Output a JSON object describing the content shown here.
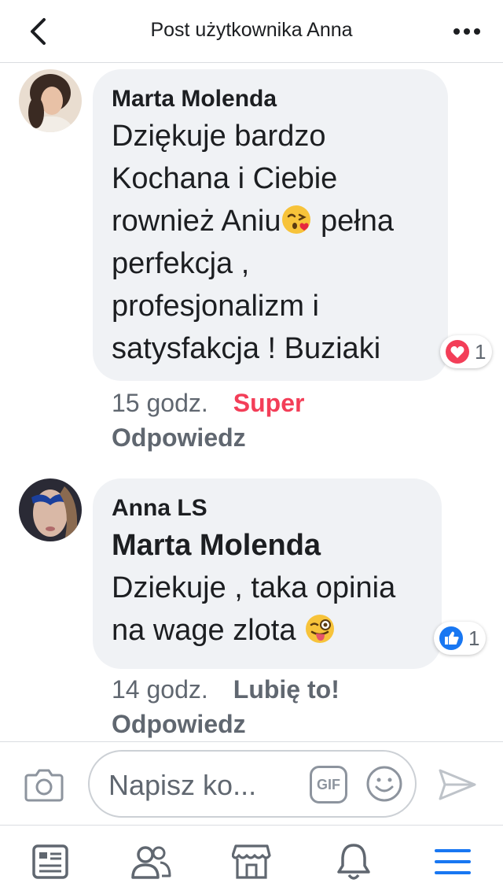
{
  "header": {
    "title": "Post użytkownika Anna",
    "back_icon": "chevron-left-icon",
    "more_icon": "more-dots-icon"
  },
  "comments": [
    {
      "author": "Marta Molenda",
      "text_lines": [
        "Dziękuje bardzo",
        "Kochana i Ciebie",
        "rownież Aniu",
        "perfekcja ,",
        "profesjonalizm i",
        "satysfakcja ! Buziaki"
      ],
      "line3_suffix": " pełna",
      "emoji": "kissing-face-emoji",
      "reaction": {
        "type": "love",
        "count": "1"
      },
      "time": "15 godz.",
      "reaction_label": "Super",
      "reply_label": "Odpowiedz"
    },
    {
      "author": "Anna LS",
      "mention": "Marta Molenda",
      "text_lines": [
        "Dziekuje , taka opinia",
        "na wage zlota"
      ],
      "emoji": "winking-tongue-emoji",
      "reaction": {
        "type": "like",
        "count": "1"
      },
      "time": "14 godz.",
      "reaction_label": "Lubię to!",
      "reply_label": "Odpowiedz"
    }
  ],
  "composer": {
    "placeholder": "Napisz ko...",
    "gif_label": "GIF",
    "camera_icon": "camera-icon",
    "smile_icon": "smiley-icon",
    "send_icon": "send-icon"
  },
  "tabs": [
    {
      "icon": "news-feed-icon"
    },
    {
      "icon": "friends-icon"
    },
    {
      "icon": "marketplace-icon"
    },
    {
      "icon": "notifications-bell-icon"
    },
    {
      "icon": "menu-hamburger-icon"
    }
  ],
  "colors": {
    "bubble": "#f0f2f5",
    "love": "#f33e58",
    "like": "#1877f2",
    "menu_active": "#1877f2",
    "icon_gray": "#606770"
  }
}
